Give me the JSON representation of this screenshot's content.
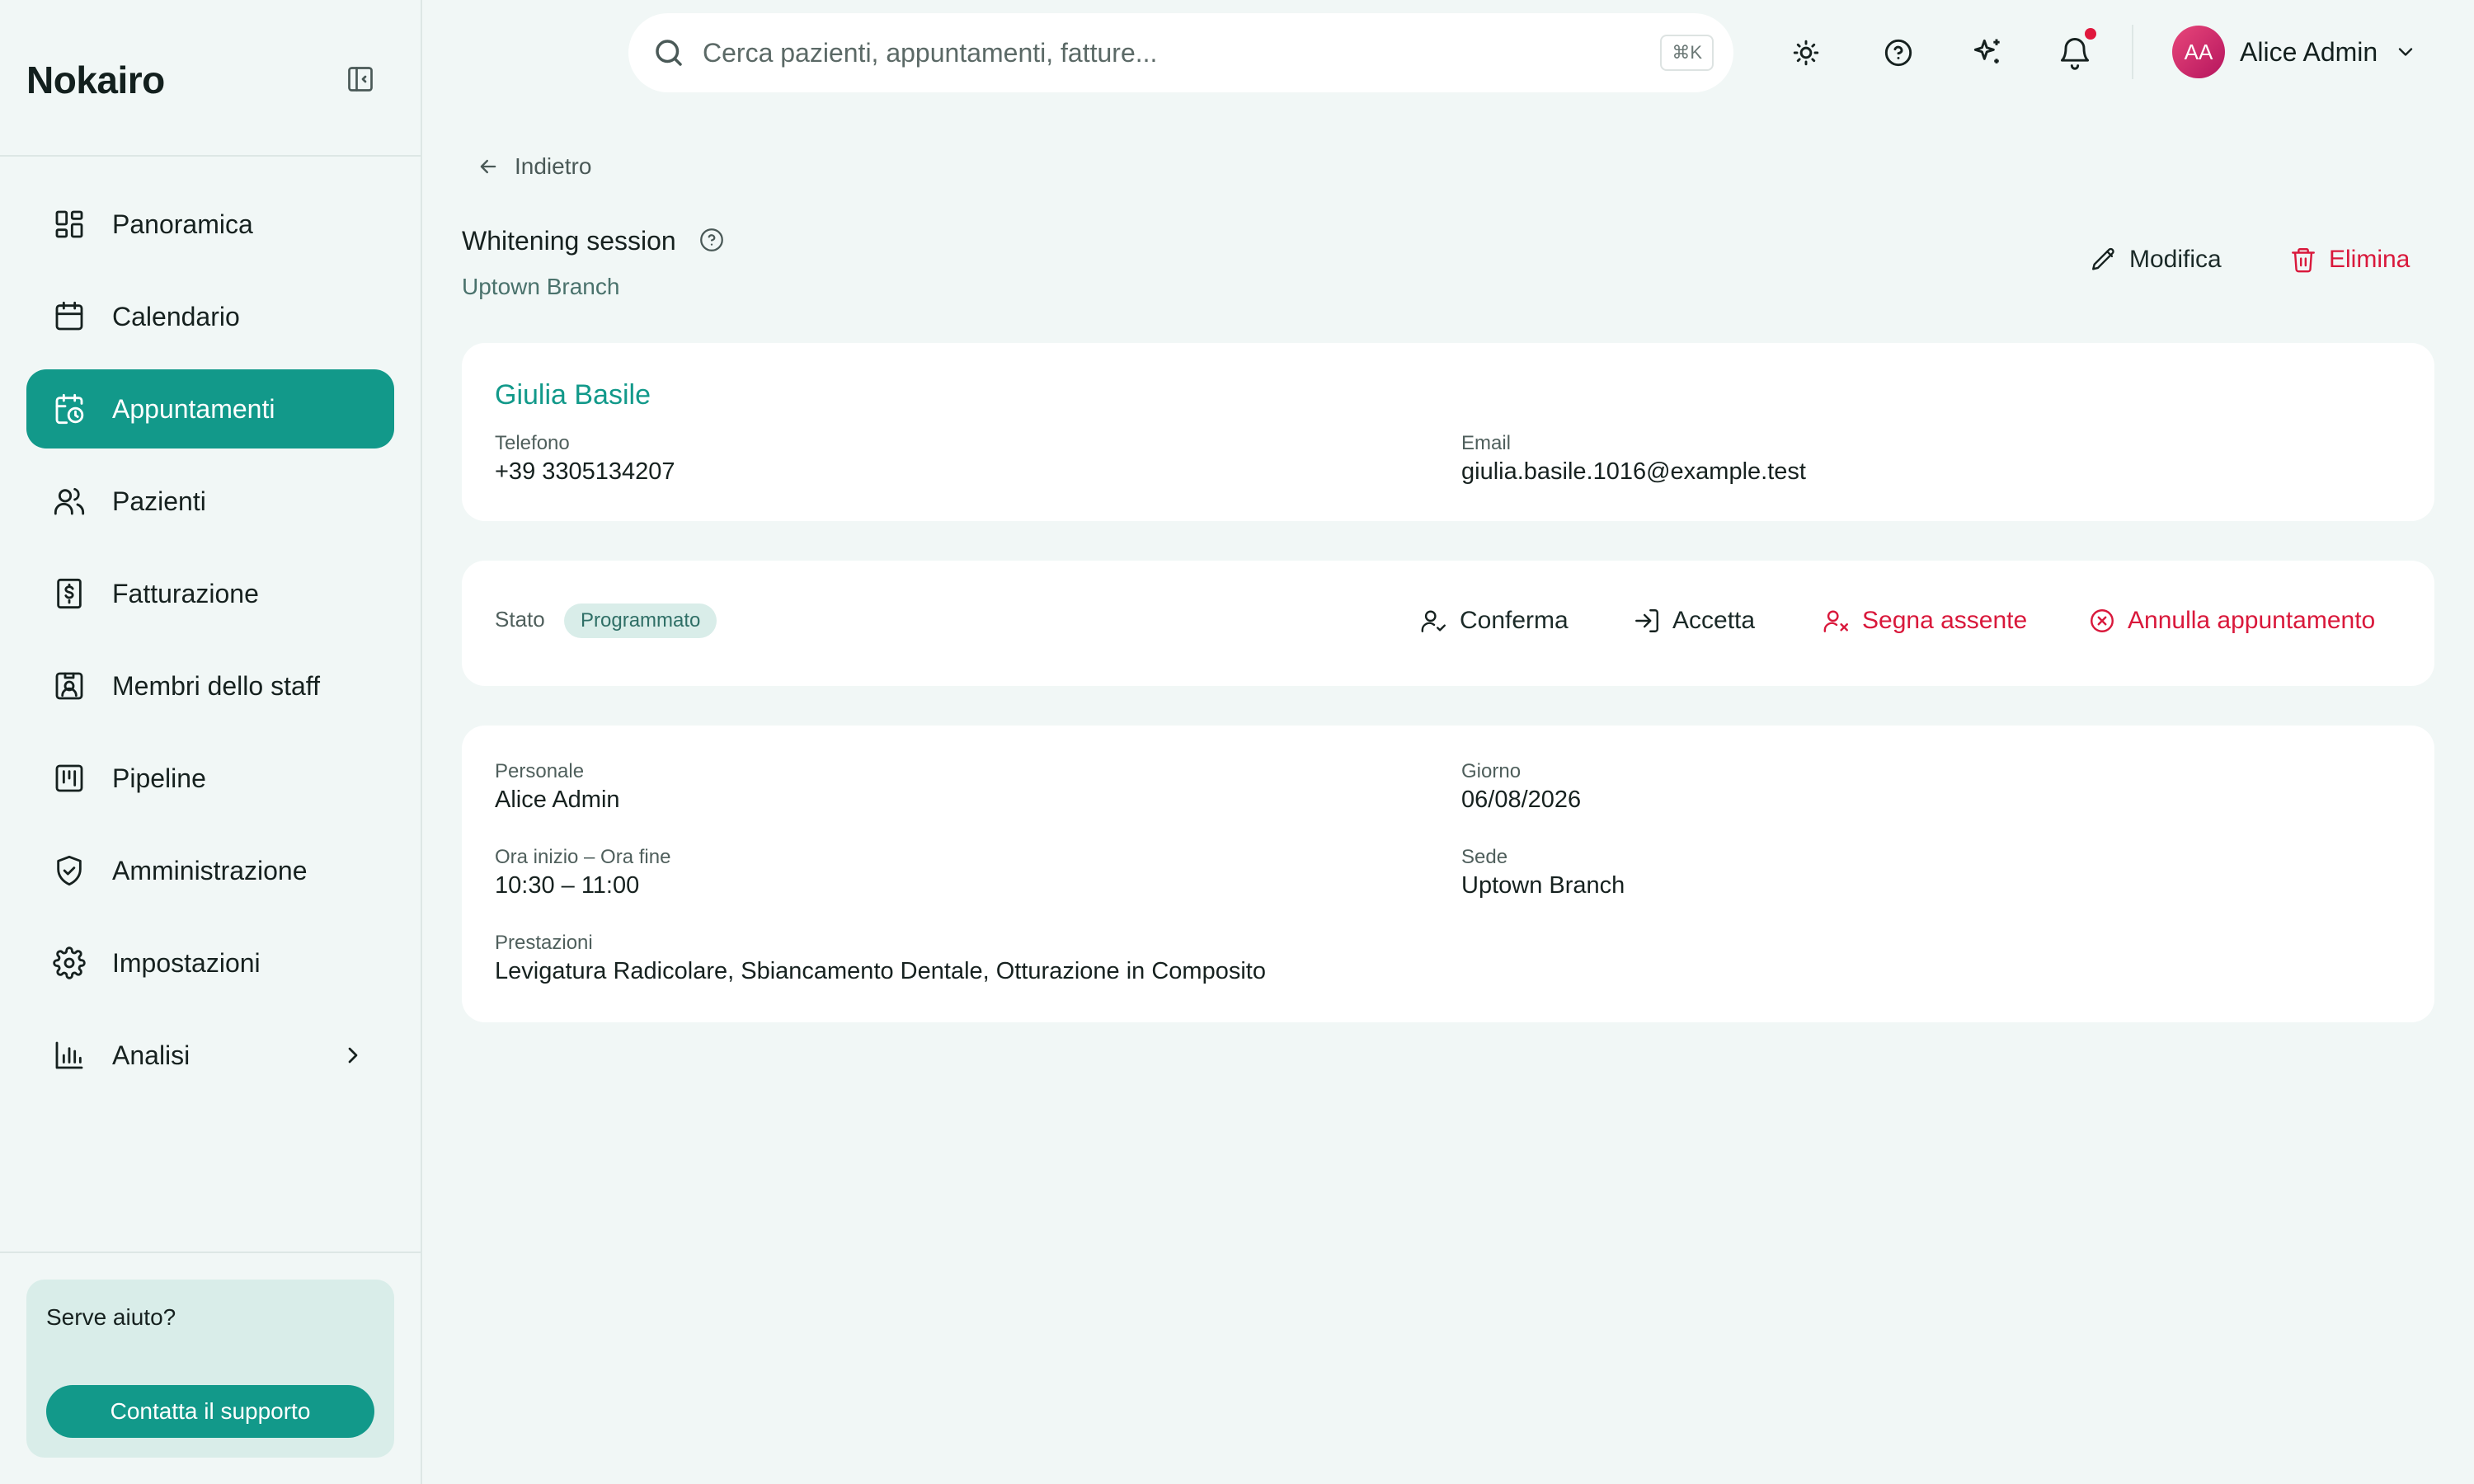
{
  "app": {
    "brand": "Nokairo"
  },
  "sidebar": {
    "items": [
      {
        "label": "Panoramica",
        "icon": "dashboard-icon"
      },
      {
        "label": "Calendario",
        "icon": "calendar-icon"
      },
      {
        "label": "Appuntamenti",
        "icon": "calendar-clock-icon",
        "active": true
      },
      {
        "label": "Pazienti",
        "icon": "users-icon"
      },
      {
        "label": "Fatturazione",
        "icon": "receipt-dollar-icon"
      },
      {
        "label": "Membri dello staff",
        "icon": "id-badge-icon"
      },
      {
        "label": "Pipeline",
        "icon": "kanban-icon"
      },
      {
        "label": "Amministrazione",
        "icon": "shield-check-icon"
      },
      {
        "label": "Impostazioni",
        "icon": "gear-icon"
      },
      {
        "label": "Analisi",
        "icon": "bar-chart-icon"
      }
    ],
    "help": {
      "title": "Serve aiuto?",
      "button": "Contatta il supporto"
    }
  },
  "topbar": {
    "search_placeholder": "Cerca pazienti, appuntamenti, fatture...",
    "shortcut": "⌘K",
    "user": {
      "initials": "AA",
      "name": "Alice Admin"
    }
  },
  "page": {
    "back_label": "Indietro",
    "title": "Whitening session",
    "subtitle": "Uptown Branch",
    "edit_label": "Modifica",
    "delete_label": "Elimina"
  },
  "patient": {
    "name": "Giulia Basile",
    "phone_label": "Telefono",
    "phone": "+39 3305134207",
    "email_label": "Email",
    "email": "giulia.basile.1016@example.test"
  },
  "status": {
    "label": "Stato",
    "value": "Programmato",
    "actions": {
      "confirm": "Conferma",
      "accept": "Accetta",
      "no_show": "Segna assente",
      "cancel": "Annulla appuntamento"
    }
  },
  "details": {
    "staff_label": "Personale",
    "staff": "Alice Admin",
    "day_label": "Giorno",
    "day": "06/08/2026",
    "time_label": "Ora inizio – Ora fine",
    "time": "10:30 – 11:00",
    "location_label": "Sede",
    "location": "Uptown Branch",
    "services_label": "Prestazioni",
    "services": "Levigatura Radicolare, Sbiancamento Dentale, Otturazione in Composito"
  },
  "colors": {
    "accent": "#12998a",
    "danger": "#d9183b",
    "background": "#f1f7f6"
  }
}
